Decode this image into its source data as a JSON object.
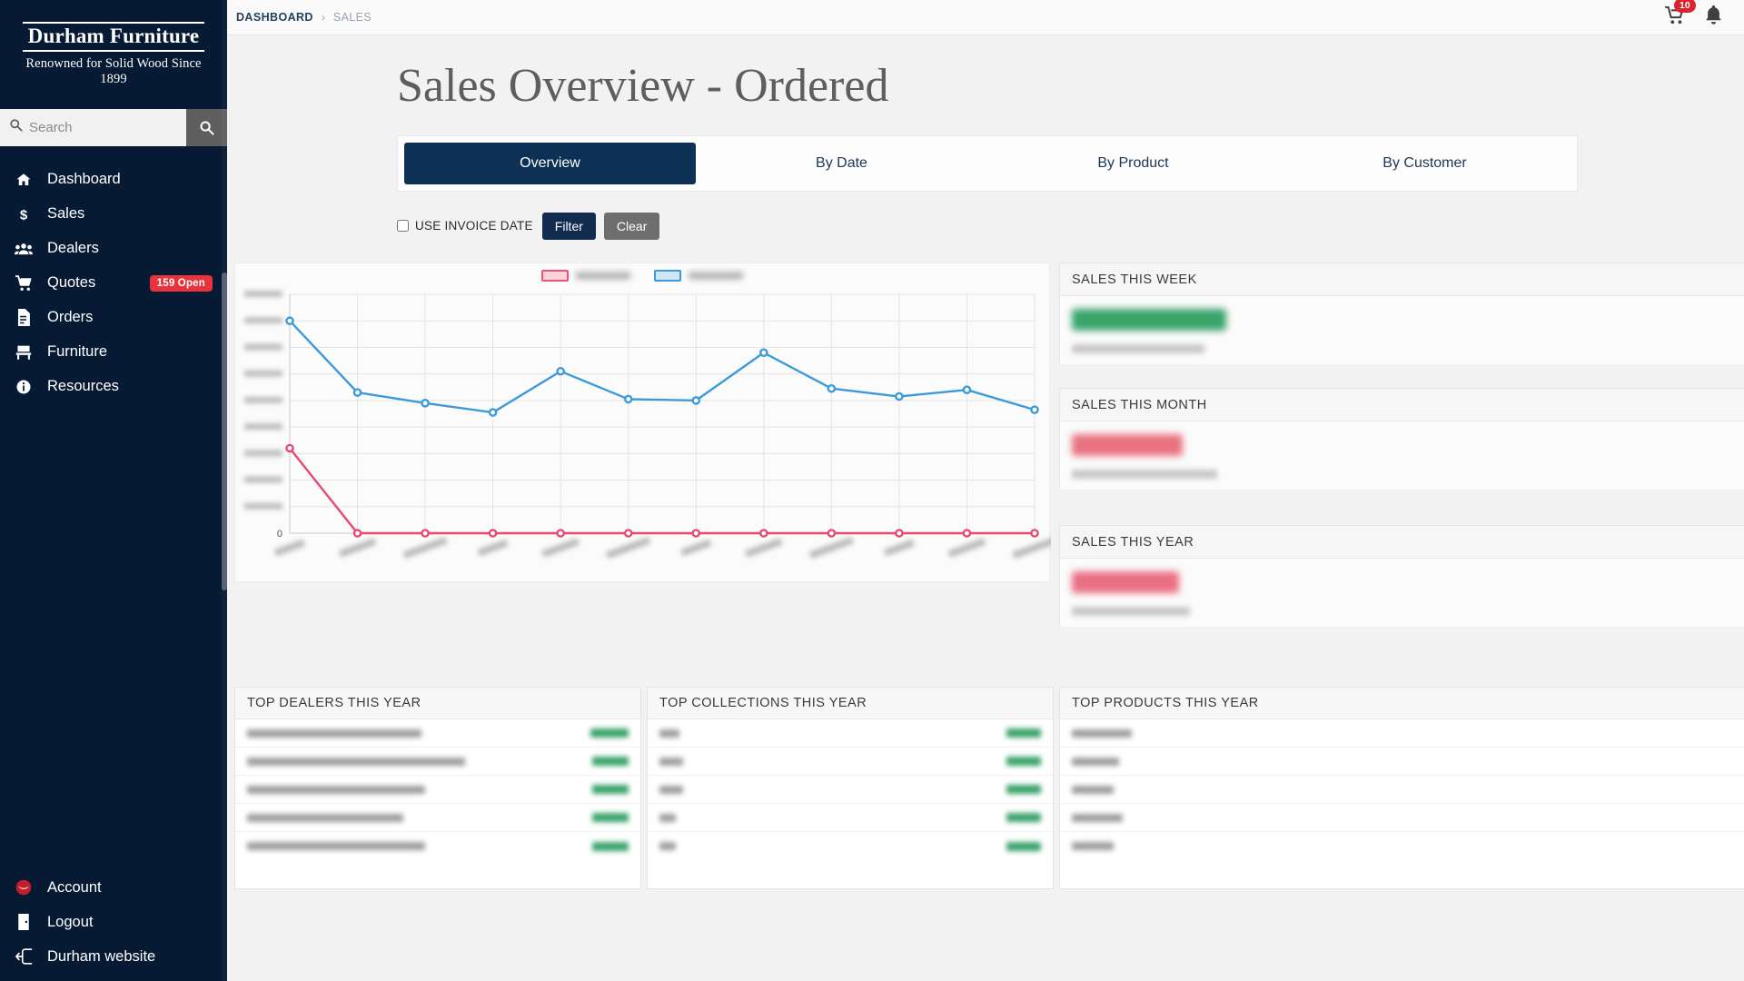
{
  "sidebar": {
    "brand_name": "Durham Furniture",
    "brand_tagline": "Renowned for Solid Wood Since 1899",
    "search": {
      "placeholder": "Search",
      "value": "",
      "icon": "search-icon",
      "button_icon": "search-icon"
    },
    "items": [
      {
        "label": "Dashboard",
        "icon": "home-icon",
        "badge": ""
      },
      {
        "label": "Sales",
        "icon": "dollar-icon",
        "badge": ""
      },
      {
        "label": "Dealers",
        "icon": "users-icon",
        "badge": ""
      },
      {
        "label": "Quotes",
        "icon": "cart-icon",
        "badge": "159 Open"
      },
      {
        "label": "Orders",
        "icon": "document-icon",
        "badge": ""
      },
      {
        "label": "Furniture",
        "icon": "chair-icon",
        "badge": ""
      },
      {
        "label": "Resources",
        "icon": "info-icon",
        "badge": ""
      }
    ],
    "bottom_items": [
      {
        "label": "Account",
        "icon": "account-avatar-icon"
      },
      {
        "label": "Logout",
        "icon": "door-exit-icon"
      },
      {
        "label": "Durham website",
        "icon": "external-link-icon"
      }
    ],
    "bg_color": "#071a33",
    "badge_color": "#e8323c"
  },
  "topbar": {
    "breadcrumb_root": "DASHBOARD",
    "breadcrumb_separator": "›",
    "breadcrumb_current": "SALES",
    "cart_icon": "cart-icon",
    "cart_badge": "10",
    "bell_icon": "bell-icon",
    "badge_color": "#dc2430"
  },
  "main": {
    "page_title": "Sales Overview - Ordered",
    "tabs": [
      {
        "label": "Overview",
        "active": true
      },
      {
        "label": "By Date",
        "active": false
      },
      {
        "label": "By Product",
        "active": false
      },
      {
        "label": "By Customer",
        "active": false
      }
    ],
    "active_tab_color": "#0d3154",
    "filters": {
      "use_invoice_date_label": "USE INVOICE DATE",
      "use_invoice_date_checked": false,
      "filter_button": "Filter",
      "clear_button": "Clear"
    }
  },
  "chart_data": {
    "type": "line",
    "title": "",
    "xlabel": "",
    "ylabel": "",
    "grid": true,
    "legend_position": "top-center",
    "note": "Axis tick labels, legend labels and month labels are privacy-blurred in the source screenshot; only the 0 baseline tick is legible.",
    "categories": [
      "",
      "",
      "",
      "",
      "",
      "",
      "",
      "",
      "",
      "",
      "",
      ""
    ],
    "x_tick_labels_blurred": true,
    "y_tick_labels_blurred": true,
    "y_baseline_label": "0",
    "ylim": [
      0,
      900000
    ],
    "y_ticks": [
      0,
      100000,
      200000,
      300000,
      400000,
      500000,
      600000,
      700000,
      800000,
      900000
    ],
    "series": [
      {
        "name": "",
        "color": "#e8496e",
        "values": [
          320000,
          0,
          0,
          0,
          0,
          0,
          0,
          0,
          0,
          0,
          0,
          0
        ]
      },
      {
        "name": "",
        "color": "#3d9ada",
        "values": [
          800000,
          530000,
          490000,
          455000,
          610000,
          505000,
          500000,
          680000,
          545000,
          515000,
          540000,
          465000
        ]
      }
    ]
  },
  "kpi_cards": [
    {
      "title": "SALES THIS WEEK",
      "value_blurred": true,
      "value_color": "#3aa36a",
      "value_width": 170,
      "sub_blurred": true
    },
    {
      "title": "SALES THIS MONTH",
      "value_blurred": true,
      "value_color": "#e8727e",
      "value_width": 122,
      "sub_blurred": true
    },
    {
      "title": "SALES THIS YEAR",
      "value_blurred": true,
      "value_color": "#ea6f82",
      "value_width": 118,
      "sub_blurred": true
    }
  ],
  "list_cards": [
    {
      "title": "TOP DEALERS THIS YEAR",
      "rows": [
        {
          "name_width": 192,
          "value_width": 42
        },
        {
          "name_width": 240,
          "value_width": 40
        },
        {
          "name_width": 196,
          "value_width": 40
        },
        {
          "name_width": 172,
          "value_width": 40
        },
        {
          "name_width": 196,
          "value_width": 40
        }
      ]
    },
    {
      "title": "TOP COLLECTIONS THIS YEAR",
      "rows": [
        {
          "name_width": 22,
          "value_width": 38
        },
        {
          "name_width": 26,
          "value_width": 38
        },
        {
          "name_width": 26,
          "value_width": 38
        },
        {
          "name_width": 18,
          "value_width": 38
        },
        {
          "name_width": 18,
          "value_width": 38
        }
      ]
    },
    {
      "title": "TOP PRODUCTS THIS YEAR",
      "rows": [
        {
          "name_width": 66,
          "value_width": 34
        },
        {
          "name_width": 52,
          "value_width": 34
        },
        {
          "name_width": 46,
          "value_width": 34
        },
        {
          "name_width": 56,
          "value_width": 34
        },
        {
          "name_width": 46,
          "value_width": 34
        }
      ]
    }
  ]
}
